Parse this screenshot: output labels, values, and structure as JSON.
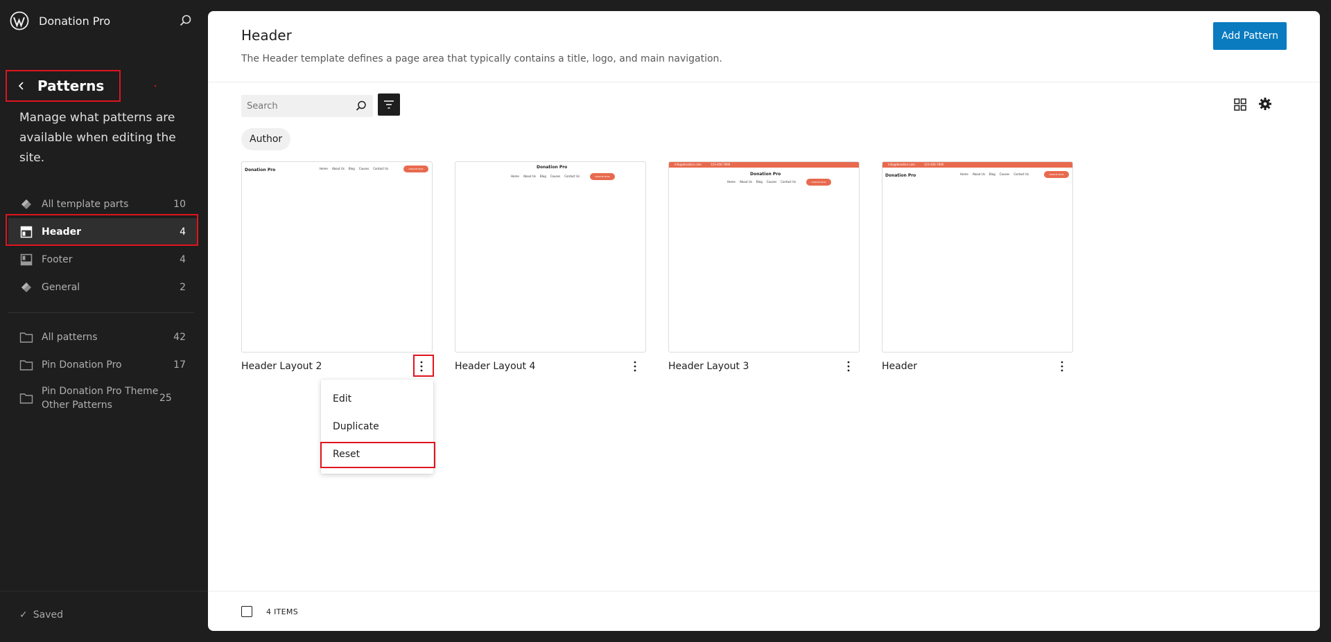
{
  "site": {
    "name": "Donation Pro"
  },
  "sidebar": {
    "heading": "Patterns",
    "description": "Manage what patterns are available when editing the site.",
    "template_parts": [
      {
        "label": "All template parts",
        "count": "10",
        "icon": "diamond-icon"
      },
      {
        "label": "Header",
        "count": "4",
        "icon": "header-layout-icon",
        "active": true
      },
      {
        "label": "Footer",
        "count": "4",
        "icon": "footer-layout-icon"
      },
      {
        "label": "General",
        "count": "2",
        "icon": "diamond-icon"
      }
    ],
    "pattern_groups": [
      {
        "label": "All patterns",
        "count": "42",
        "icon": "folder-icon"
      },
      {
        "label": "Pin Donation Pro",
        "count": "17",
        "icon": "folder-icon"
      },
      {
        "label": "Pin Donation Pro Theme Other Patterns",
        "count": "25",
        "icon": "folder-icon"
      }
    ],
    "status": "Saved"
  },
  "main": {
    "title": "Header",
    "description": "The Header template defines a page area that typically contains a title, logo, and main navigation.",
    "add_button": "Add Pattern",
    "search_placeholder": "Search",
    "filter_chip": "Author",
    "cards": [
      {
        "title": "Header Layout 2"
      },
      {
        "title": "Header Layout 4"
      },
      {
        "title": "Header Layout 3"
      },
      {
        "title": "Header"
      }
    ],
    "preview": {
      "logo": "Donation Pro",
      "nav": [
        "Home",
        "About Us",
        "Blog",
        "Causes",
        "Contact Us"
      ],
      "button": "DONATE NOW",
      "email": "info@donation.com",
      "phone": "123-456-7890"
    },
    "menu": [
      "Edit",
      "Duplicate",
      "Reset"
    ],
    "items_count": "4 ITEMS"
  },
  "colors": {
    "accent": "#0a7bbf",
    "highlight": "#e0141e",
    "preview_brand": "#e86a4e"
  }
}
